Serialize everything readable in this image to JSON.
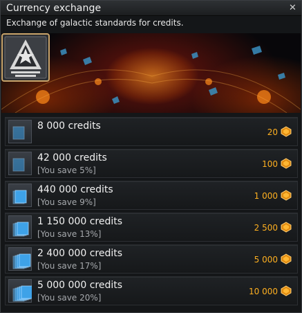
{
  "window": {
    "title": "Currency exchange",
    "close_glyph": "✕",
    "subtitle": "Exchange of galactic standards for credits."
  },
  "colors": {
    "price": "#ffb020",
    "banner_fire": "#ff7a00",
    "icon_blue": "#3ea2e8"
  },
  "icons": {
    "banner_emblem": "faction-star-emblem-icon",
    "row_icon": "credit-cards-icon",
    "price_icon": "galactic-standard-coin-icon"
  },
  "offers": [
    {
      "amount": "8 000 credits",
      "save": "",
      "price": "20",
      "stack": 1
    },
    {
      "amount": "42 000 credits",
      "save": "[You save 5%]",
      "price": "100",
      "stack": 1
    },
    {
      "amount": "440 000 credits",
      "save": "[You save 9%]",
      "price": "1 000",
      "stack": 2
    },
    {
      "amount": "1 150 000 credits",
      "save": "[You save 13%]",
      "price": "2 500",
      "stack": 3
    },
    {
      "amount": "2 400 000 credits",
      "save": "[You save 17%]",
      "price": "5 000",
      "stack": 4
    },
    {
      "amount": "5 000 000 credits",
      "save": "[You save 20%]",
      "price": "10 000",
      "stack": 5
    }
  ]
}
